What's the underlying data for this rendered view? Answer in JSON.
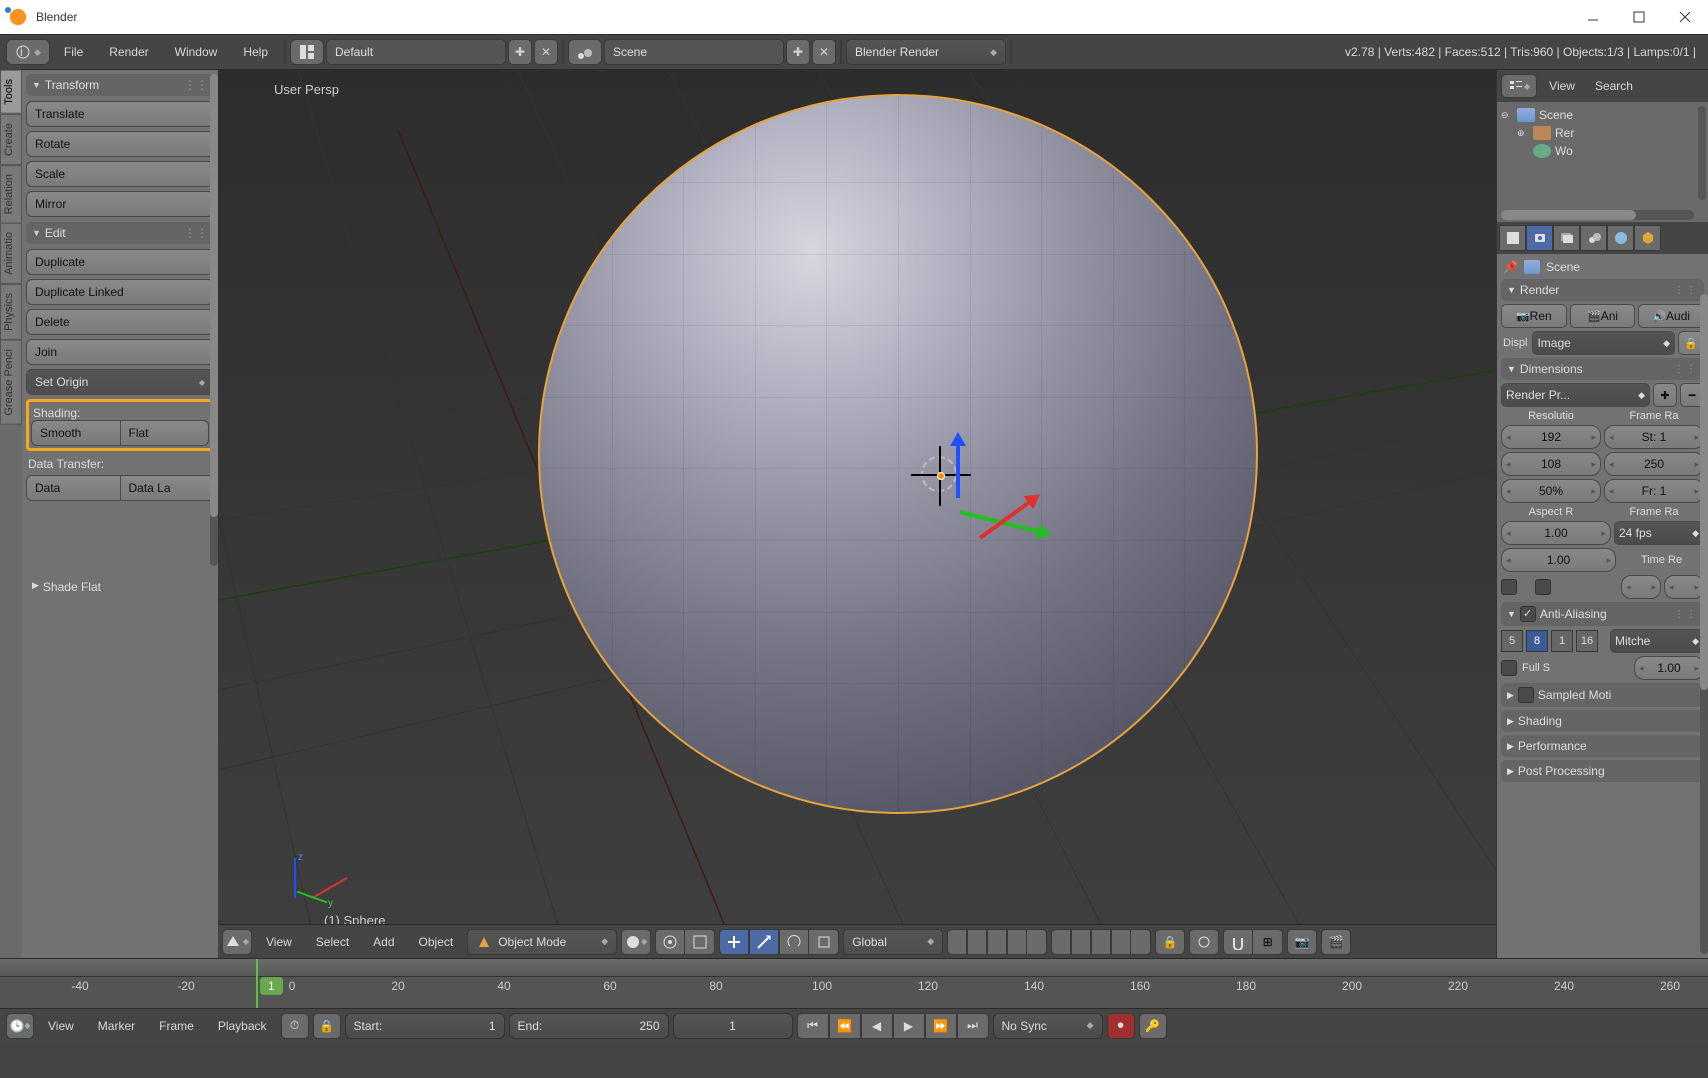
{
  "app": {
    "title": "Blender",
    "version": "v2.78"
  },
  "menu": {
    "file": "File",
    "render": "Render",
    "window": "Window",
    "help": "Help",
    "layout": "Default",
    "scene": "Scene",
    "engine": "Blender Render"
  },
  "stats": {
    "verts": "Verts:482",
    "faces": "Faces:512",
    "tris": "Tris:960",
    "objects": "Objects:1/3",
    "lamps": "Lamps:0/1"
  },
  "tooltabs": [
    "Tools",
    "Create",
    "Relation",
    "Animatio",
    "Physics",
    "Grease Penci"
  ],
  "tools": {
    "transform": {
      "title": "Transform",
      "translate": "Translate",
      "rotate": "Rotate",
      "scale": "Scale",
      "mirror": "Mirror"
    },
    "edit": {
      "title": "Edit",
      "duplicate": "Duplicate",
      "duplicate_linked": "Duplicate Linked",
      "delete": "Delete",
      "join": "Join",
      "set_origin": "Set Origin"
    },
    "shading": {
      "title": "Shading:",
      "smooth": "Smooth",
      "flat": "Flat"
    },
    "datatransfer": {
      "title": "Data Transfer:",
      "data": "Data",
      "data_la": "Data La"
    }
  },
  "history": {
    "last_op": "Shade Flat"
  },
  "viewport": {
    "persp": "User Persp",
    "object_label": "(1) Sphere",
    "header": {
      "view": "View",
      "select": "Select",
      "add": "Add",
      "object": "Object",
      "mode": "Object Mode",
      "orientation": "Global"
    }
  },
  "outliner": {
    "hdr_view": "View",
    "hdr_search": "Search",
    "tree": {
      "scene": "Scene",
      "rer": "Rer",
      "wo": "Wo"
    },
    "pin_label": "Scene"
  },
  "props": {
    "render": {
      "title": "Render",
      "btn_ren": "Ren",
      "btn_ani": "Ani",
      "btn_audi": "Audi",
      "displ": "Displ",
      "image": "Image"
    },
    "dim": {
      "title": "Dimensions",
      "preset": "Render Pr...",
      "col_res": "Resolutio",
      "col_fr": "Frame Ra",
      "res_x": "192",
      "res_y": "108",
      "res_pct": "50%",
      "fr_st": "St: 1",
      "fr_end": "250",
      "fr_fr": "Fr: 1",
      "aspect": "Aspect R",
      "fr2": "Frame Ra",
      "asp_x": "1.00",
      "asp_y": "1.00",
      "fps": "24 fps",
      "time_re": "Time Re"
    },
    "aa": {
      "title": "Anti-Aliasing",
      "s5": "5",
      "s8": "8",
      "s1": "1",
      "s16": "16",
      "filter": "Mitche",
      "full_s": "Full S",
      "full_v": "1.00"
    },
    "sampled": "Sampled Moti",
    "shading": "Shading",
    "perf": "Performance",
    "post": "Post Processing"
  },
  "timeline": {
    "ticks": [
      "-40",
      "-20",
      "0",
      "20",
      "40",
      "60",
      "80",
      "100",
      "120",
      "140",
      "160",
      "180",
      "200",
      "220",
      "240",
      "260"
    ],
    "current": "1",
    "hdr": {
      "view": "View",
      "marker": "Marker",
      "frame": "Frame",
      "playback": "Playback",
      "start": "Start:",
      "start_v": "1",
      "end": "End:",
      "end_v": "250",
      "cur_v": "1",
      "sync": "No Sync"
    }
  }
}
